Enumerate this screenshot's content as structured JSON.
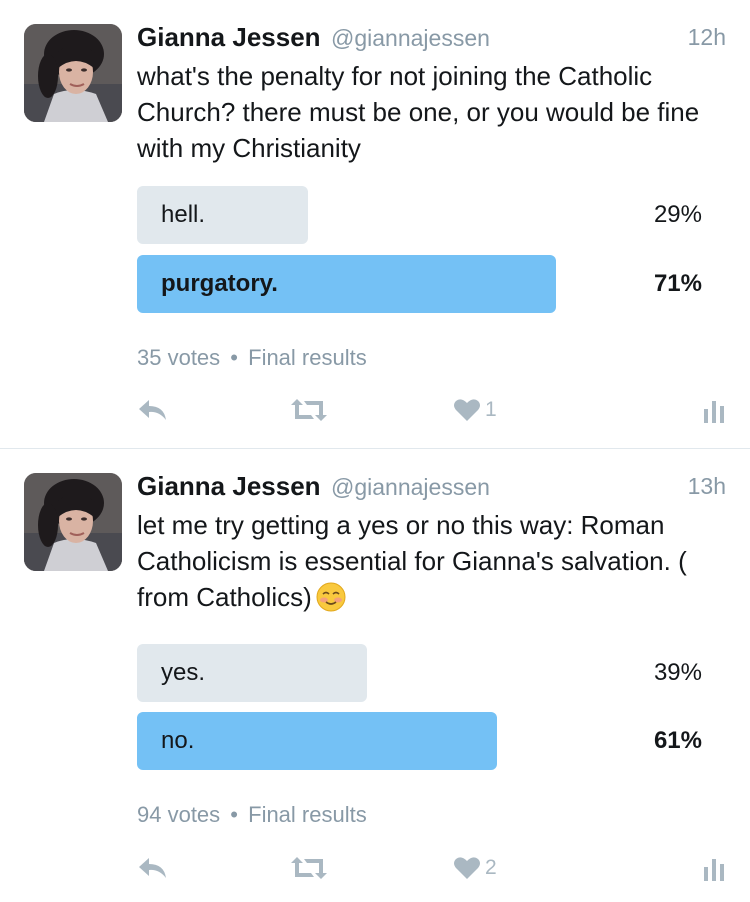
{
  "tweets": [
    {
      "name": "Gianna Jessen",
      "handle": "@giannajessen",
      "time": "12h",
      "text": "what's the penalty for not joining the Catholic Church? there must be one, or you would be fine with my Christianity",
      "emoji": "",
      "poll": {
        "choices": [
          {
            "label": "hell.",
            "percent": "29%",
            "value": 29,
            "winner": false
          },
          {
            "label": "purgatory.",
            "percent": "71%",
            "value": 71,
            "winner": true
          }
        ],
        "votes": "35 votes",
        "status": "Final results"
      },
      "like_count": "1"
    },
    {
      "name": "Gianna Jessen",
      "handle": "@giannajessen",
      "time": "13h",
      "text": "let me try getting a yes or no this way: Roman Catholicism is essential for Gianna's salvation. ( from Catholics)",
      "emoji": "smiling-face-with-blush-emoji",
      "poll": {
        "choices": [
          {
            "label": "yes.",
            "percent": "39%",
            "value": 39,
            "winner": false
          },
          {
            "label": "no.",
            "percent": "61%",
            "value": 61,
            "winner": true
          }
        ],
        "votes": "94 votes",
        "status": "Final results"
      },
      "like_count": "2"
    }
  ],
  "separator": "•",
  "icons": {
    "reply": "reply-icon",
    "retweet": "retweet-icon",
    "like": "heart-icon",
    "analytics": "analytics-icon"
  },
  "colors": {
    "winner_bar": "#74c1f5",
    "loser_bar": "#e1e8ed",
    "secondary_text": "#8899a6",
    "action_icon": "#aab8c2"
  }
}
